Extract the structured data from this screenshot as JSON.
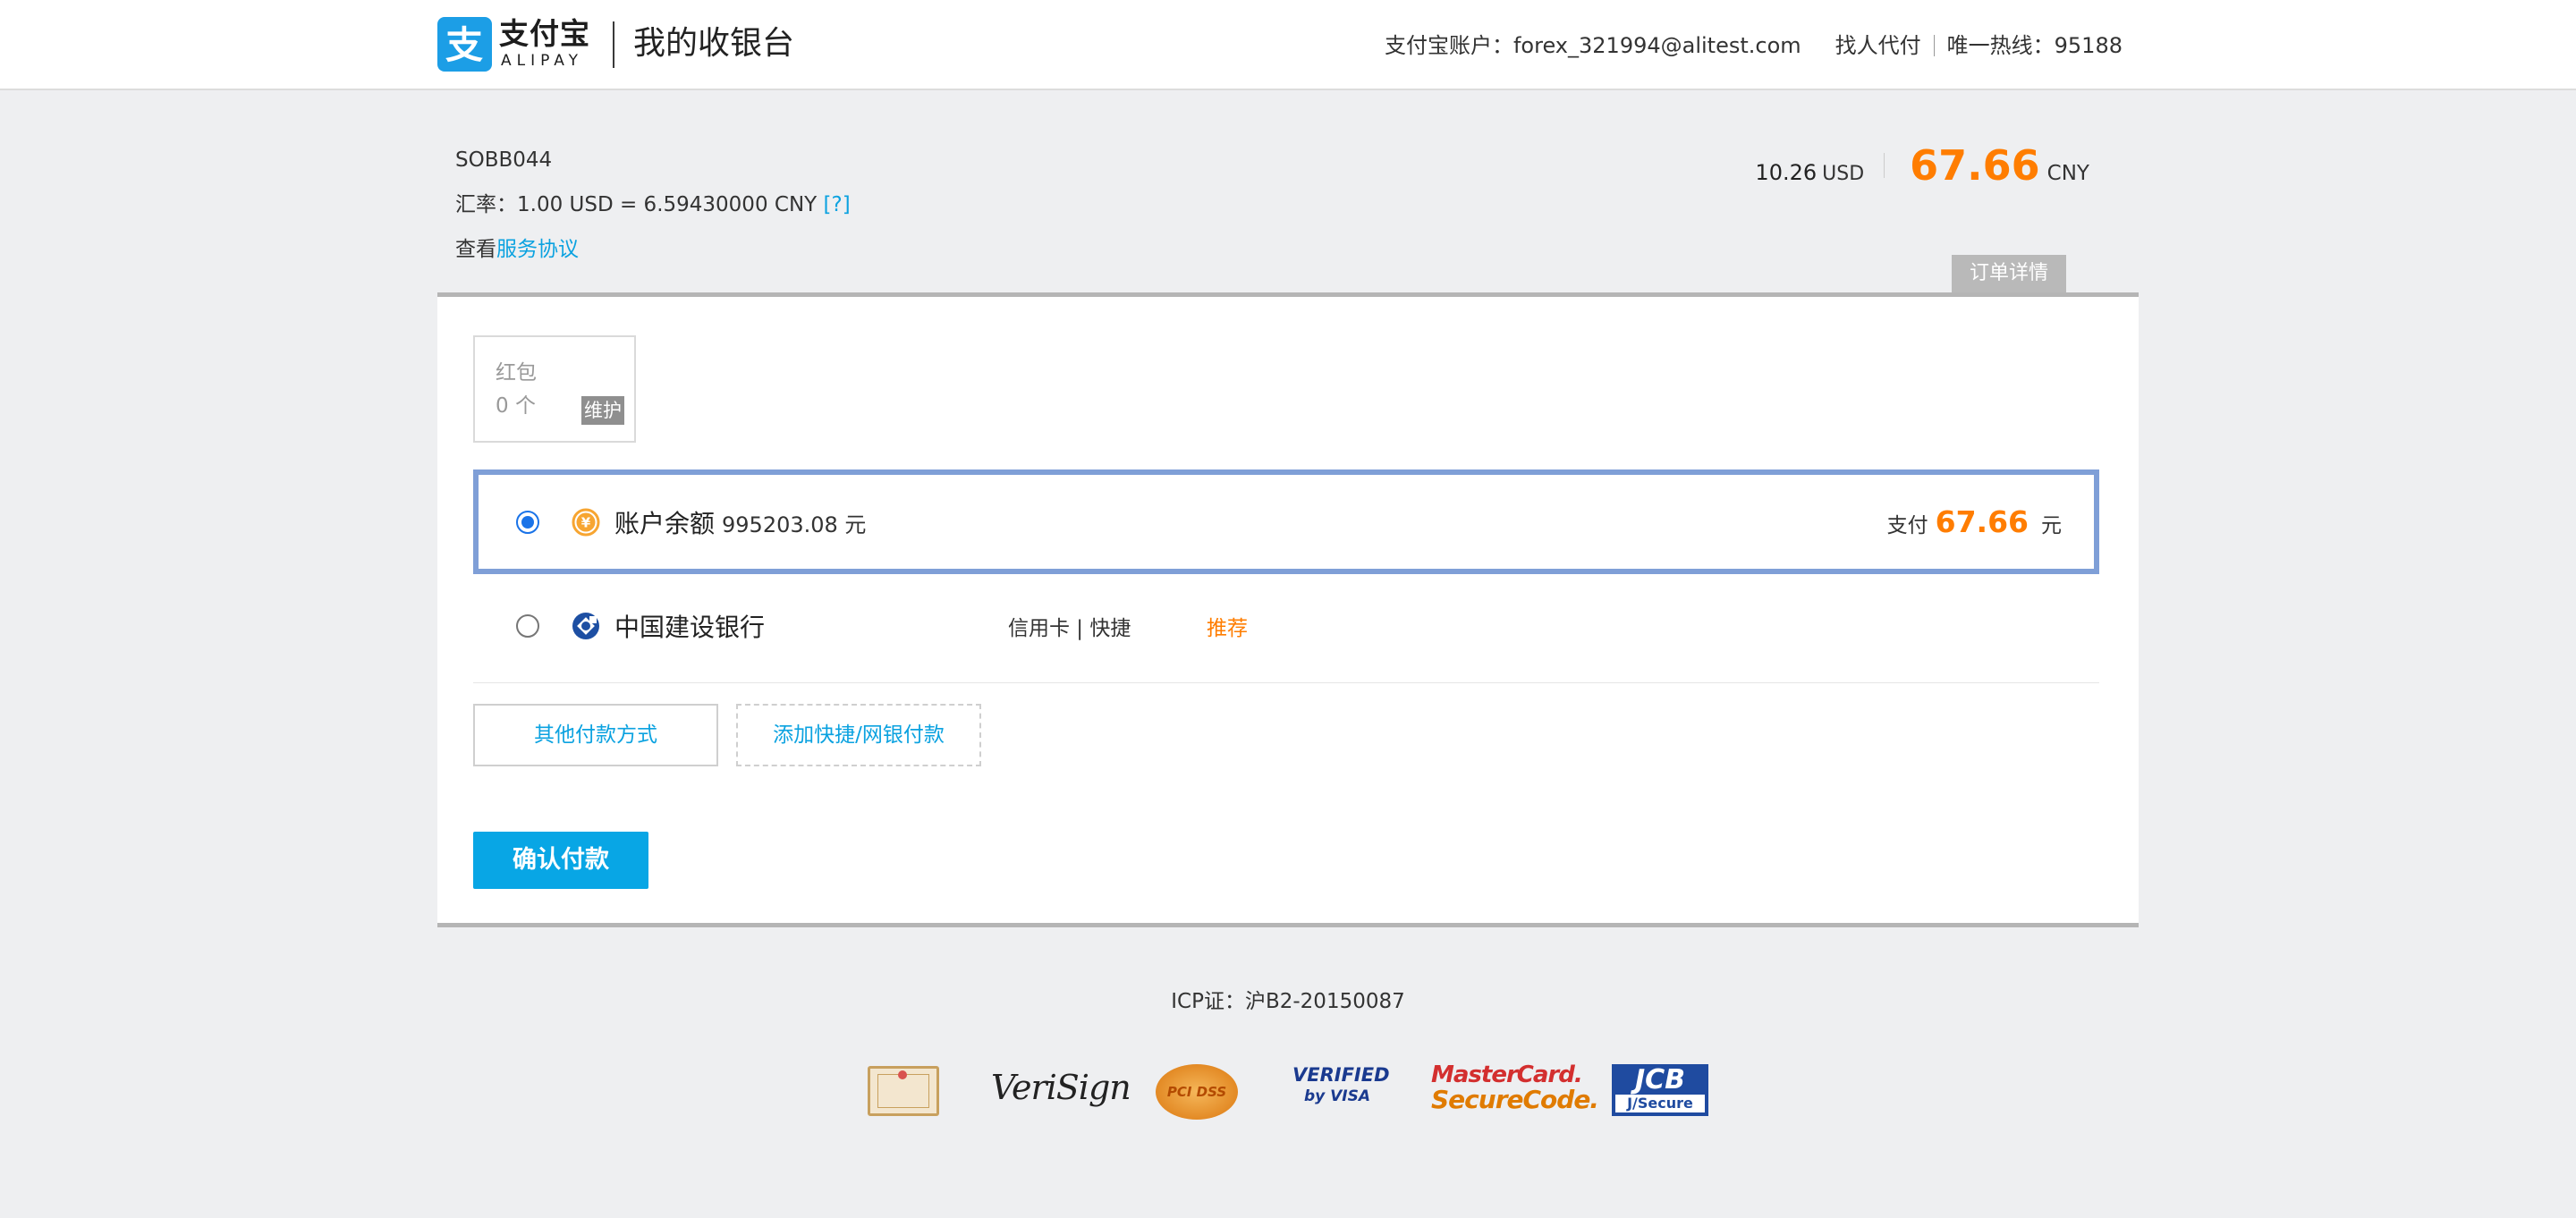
{
  "header": {
    "logo_cn": "支付宝",
    "logo_en": "ALIPAY",
    "title": "我的收银台",
    "account_label": "支付宝账户：",
    "account_value": "forex_321994@alitest.com",
    "find_payer": "找人代付",
    "hotline_label": "唯一热线：",
    "hotline_value": "95188"
  },
  "order": {
    "id": "SOBB044",
    "rate_label": "汇率：",
    "rate_value": "1.00 USD = 6.59430000 CNY",
    "rate_help": "[?]",
    "agreement_prefix": "查看",
    "agreement_link": "服务协议",
    "usd_value": "10.26",
    "usd_unit": "USD",
    "cny_value": "67.66",
    "cny_unit": "CNY",
    "detail_tab": "订单详情"
  },
  "redpacket": {
    "title": "红包",
    "count": "0 个",
    "badge": "维护"
  },
  "payment_methods": [
    {
      "name": "账户余额",
      "balance": "995203.08 元",
      "selected": true,
      "pay_label": "支付",
      "pay_value": "67.66",
      "pay_unit": "元",
      "icon": "yuan-coin-icon"
    },
    {
      "name": "中国建设银行",
      "tags": "信用卡 | 快捷",
      "recommend": "推荐",
      "selected": false,
      "icon": "ccb-bank-icon"
    }
  ],
  "buttons": {
    "other_methods": "其他付款方式",
    "add_quick": "添加快捷/网银付款",
    "confirm": "确认付款"
  },
  "footer": {
    "icp": "ICP证：沪B2-20150087",
    "certs": {
      "verisign": "VeriSign",
      "pci": "PCI DSS",
      "visa_a": "VERIFIED",
      "visa_b": "by VISA",
      "mc_a": "MasterCard.",
      "mc_b": "SecureCode.",
      "jcb_a": "JCB",
      "jcb_b": "J/Secure"
    }
  },
  "colors": {
    "brand_blue": "#1c9ee6",
    "accent_orange": "#ff7d00",
    "link_blue": "#0ba2e0",
    "selected_border": "#7f9fd7",
    "confirm_bg": "#08a6e5"
  }
}
